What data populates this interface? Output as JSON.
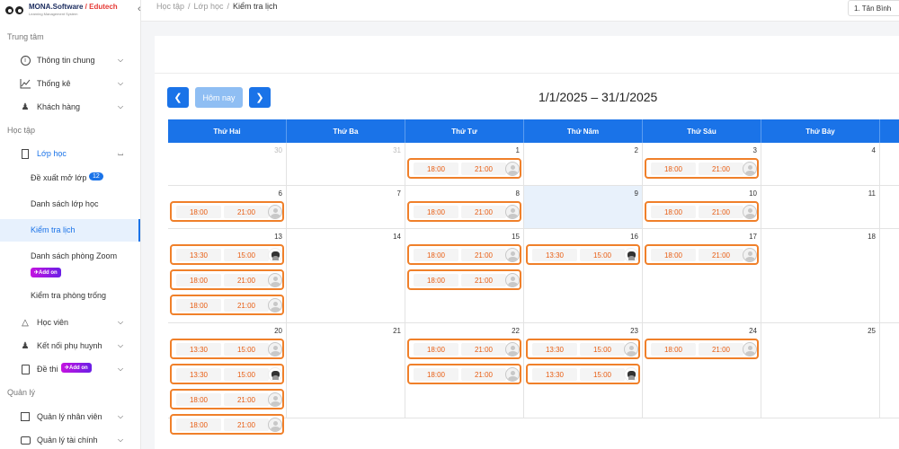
{
  "app": {
    "brand": "MONA.Software",
    "brand_sep": " / ",
    "brand_accent": "Edutech",
    "brand_sub": "Learning Management System"
  },
  "sidebar": {
    "section_center": "Trung tâm",
    "general_info": "Thông tin chung",
    "stats": "Thống kê",
    "customers": "Khách hàng",
    "section_study": "Học tập",
    "classes": "Lớp học",
    "propose_class": "Đề xuất mở lớp",
    "propose_count": "12",
    "class_list": "Danh sách lớp học",
    "check_schedule": "Kiểm tra lịch",
    "zoom_rooms": "Danh sách phòng Zoom",
    "addon_label": "Add on",
    "check_empty_rooms": "Kiểm tra phòng trống",
    "students": "Học viên",
    "parents": "Kết nối phụ huynh",
    "exams": "Đề thi",
    "section_manage": "Quản lý",
    "staff": "Quản lý nhân viên",
    "finance": "Quản lý tài chính"
  },
  "breadcrumb": {
    "item1": "Học tập",
    "item2": "Lớp học",
    "current": "Kiểm tra lịch",
    "sep": "/"
  },
  "branch_select": "1. Tân Bình",
  "toolbar": {
    "today": "Hôm nay",
    "range": "1/1/2025 – 31/1/2025"
  },
  "calendar": {
    "days": [
      "Thứ Hai",
      "Thứ Ba",
      "Thứ Tư",
      "Thứ Năm",
      "Thứ Sáu",
      "Thứ Bảy"
    ],
    "weeks": [
      {
        "days": [
          {
            "num": "30",
            "other": true,
            "events": []
          },
          {
            "num": "31",
            "other": true,
            "events": []
          },
          {
            "num": "1",
            "events": [
              {
                "start": "18:00",
                "end": "21:00",
                "avatar": "placeholder"
              }
            ]
          },
          {
            "num": "2",
            "events": []
          },
          {
            "num": "3",
            "events": [
              {
                "start": "18:00",
                "end": "21:00",
                "avatar": "placeholder"
              }
            ]
          },
          {
            "num": "4",
            "events": []
          }
        ]
      },
      {
        "days": [
          {
            "num": "6",
            "events": [
              {
                "start": "18:00",
                "end": "21:00",
                "avatar": "placeholder"
              }
            ]
          },
          {
            "num": "7",
            "events": []
          },
          {
            "num": "8",
            "events": [
              {
                "start": "18:00",
                "end": "21:00",
                "avatar": "placeholder"
              }
            ]
          },
          {
            "num": "9",
            "today": true,
            "events": []
          },
          {
            "num": "10",
            "events": [
              {
                "start": "18:00",
                "end": "21:00",
                "avatar": "placeholder"
              }
            ]
          },
          {
            "num": "11",
            "events": []
          }
        ]
      },
      {
        "days": [
          {
            "num": "13",
            "events": [
              {
                "start": "13:30",
                "end": "15:00",
                "avatar": "photo"
              },
              {
                "start": "18:00",
                "end": "21:00",
                "avatar": "placeholder"
              },
              {
                "start": "18:00",
                "end": "21:00",
                "avatar": "placeholder"
              }
            ]
          },
          {
            "num": "14",
            "events": []
          },
          {
            "num": "15",
            "events": [
              {
                "start": "18:00",
                "end": "21:00",
                "avatar": "placeholder"
              },
              {
                "start": "18:00",
                "end": "21:00",
                "avatar": "placeholder"
              }
            ]
          },
          {
            "num": "16",
            "events": [
              {
                "start": "13:30",
                "end": "15:00",
                "avatar": "photo"
              }
            ]
          },
          {
            "num": "17",
            "events": [
              {
                "start": "18:00",
                "end": "21:00",
                "avatar": "placeholder"
              }
            ]
          },
          {
            "num": "18",
            "events": []
          }
        ]
      },
      {
        "days": [
          {
            "num": "20",
            "events": [
              {
                "start": "13:30",
                "end": "15:00",
                "avatar": "placeholder"
              },
              {
                "start": "13:30",
                "end": "15:00",
                "avatar": "photo"
              },
              {
                "start": "18:00",
                "end": "21:00",
                "avatar": "placeholder"
              },
              {
                "start": "18:00",
                "end": "21:00",
                "avatar": "placeholder"
              }
            ]
          },
          {
            "num": "21",
            "events": []
          },
          {
            "num": "22",
            "events": [
              {
                "start": "18:00",
                "end": "21:00",
                "avatar": "placeholder"
              },
              {
                "start": "18:00",
                "end": "21:00",
                "avatar": "placeholder"
              }
            ]
          },
          {
            "num": "23",
            "events": [
              {
                "start": "13:30",
                "end": "15:00",
                "avatar": "placeholder"
              },
              {
                "start": "13:30",
                "end": "15:00",
                "avatar": "photo"
              }
            ]
          },
          {
            "num": "24",
            "events": [
              {
                "start": "18:00",
                "end": "21:00",
                "avatar": "placeholder"
              }
            ]
          },
          {
            "num": "25",
            "events": []
          }
        ]
      }
    ]
  },
  "colors": {
    "primary": "#1a73e8",
    "event_border": "#f0802a",
    "event_time": "#e85d12",
    "today_bg": "#e8f1fb"
  }
}
